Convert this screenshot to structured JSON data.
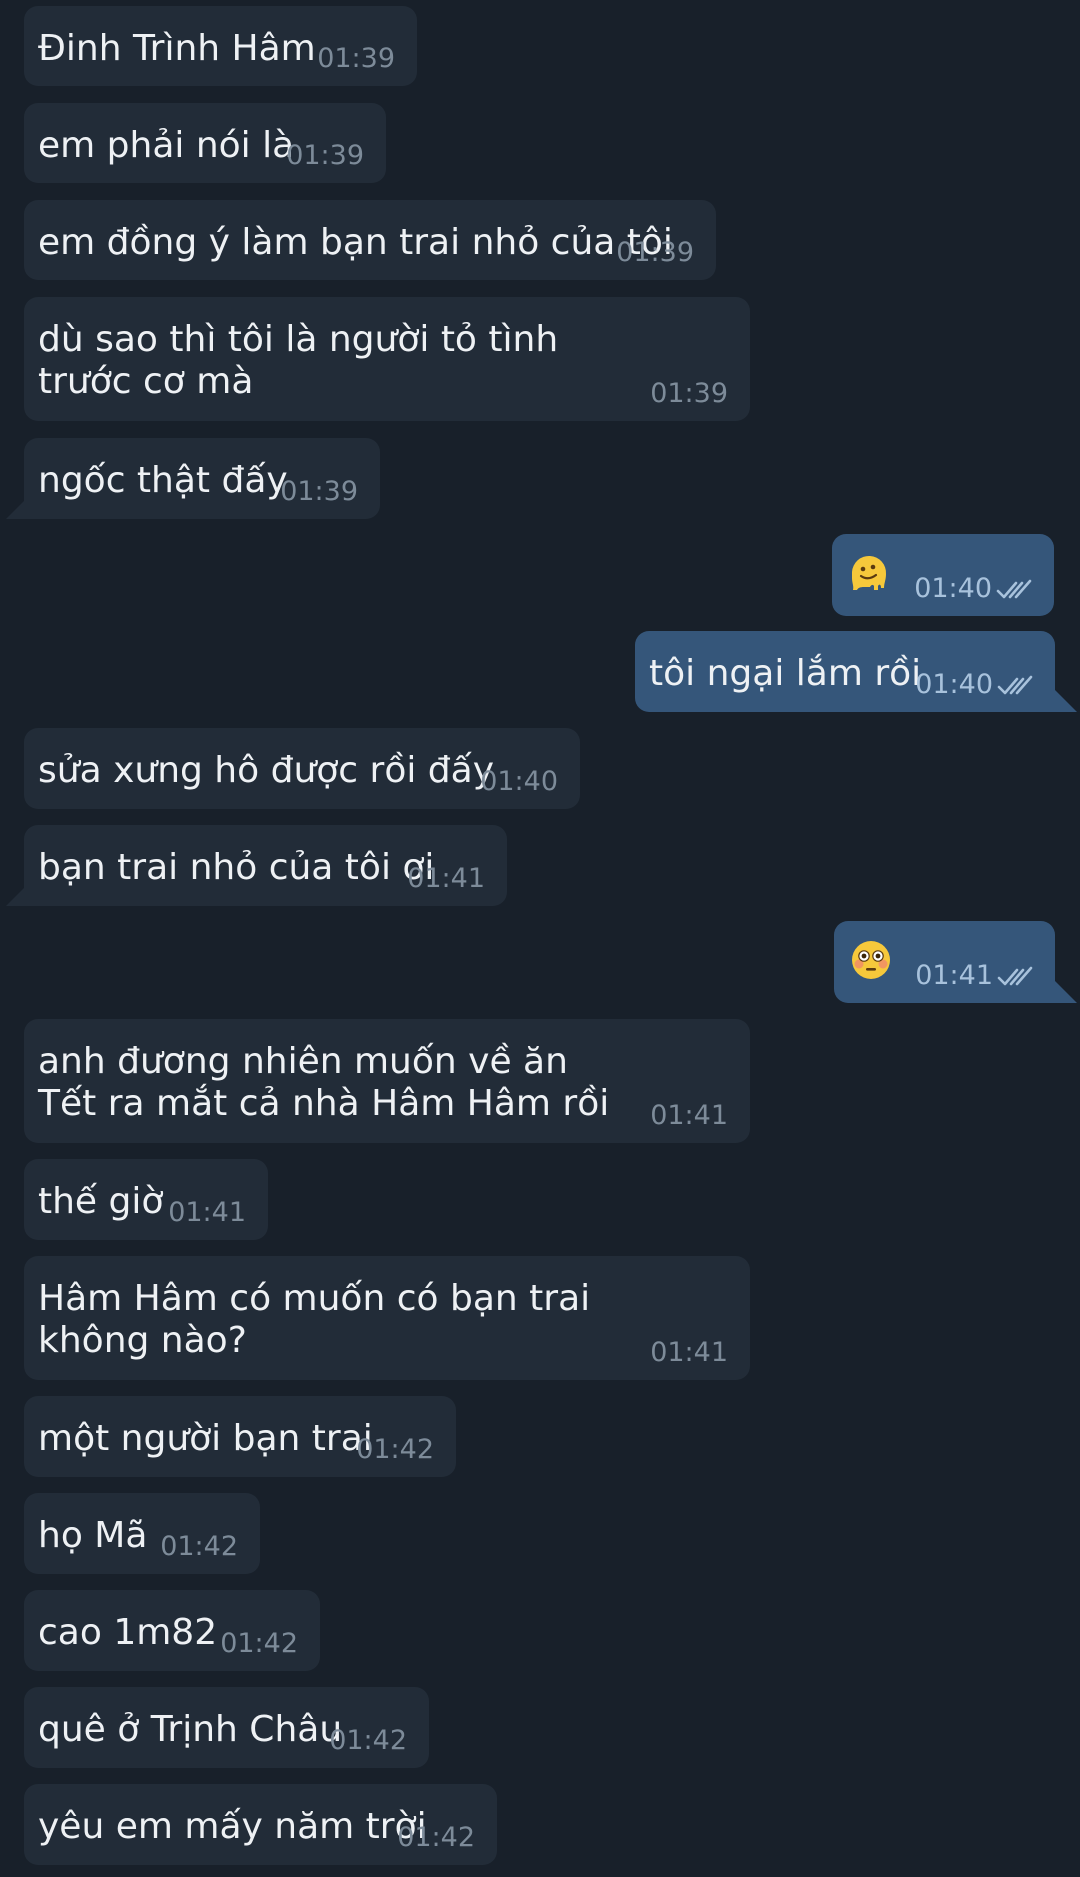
{
  "messages": [
    {
      "dir": "in",
      "text": "Đinh Trình Hâm",
      "time": "01:39"
    },
    {
      "dir": "in",
      "text": "em phải nói là",
      "time": "01:39"
    },
    {
      "dir": "in",
      "text": "em đồng ý làm bạn trai nhỏ của tôi",
      "time": "01:39"
    },
    {
      "dir": "in",
      "text": "dù sao thì tôi là người tỏ tình trước cơ mà",
      "time": "01:39"
    },
    {
      "dir": "in",
      "text": "ngốc thật đấy",
      "time": "01:39"
    },
    {
      "dir": "out",
      "emoji": "melting-face-emoji",
      "time": "01:40",
      "status": "read"
    },
    {
      "dir": "out",
      "text": "tôi ngại lắm rồi",
      "time": "01:40",
      "status": "read"
    },
    {
      "dir": "in",
      "text": "sửa xưng hô được rồi đấy",
      "time": "01:40"
    },
    {
      "dir": "in",
      "text": "bạn trai nhỏ của tôi ơi",
      "time": "01:41"
    },
    {
      "dir": "out",
      "emoji": "flushed-face-emoji",
      "time": "01:41",
      "status": "read"
    },
    {
      "dir": "in",
      "text": "anh đương nhiên muốn về ăn Tết ra mắt cả nhà Hâm Hâm rồi",
      "time": "01:41"
    },
    {
      "dir": "in",
      "text": "thế giờ",
      "time": "01:41"
    },
    {
      "dir": "in",
      "text": "Hâm Hâm có muốn có bạn trai không nào?",
      "time": "01:41"
    },
    {
      "dir": "in",
      "text": "một người bạn trai",
      "time": "01:42"
    },
    {
      "dir": "in",
      "text": "họ Mã",
      "time": "01:42"
    },
    {
      "dir": "in",
      "text": "cao 1m82",
      "time": "01:42"
    },
    {
      "dir": "in",
      "text": "quê ở Trịnh Châu",
      "time": "01:42"
    },
    {
      "dir": "in",
      "text": "yêu em mấy năm trời",
      "time": "01:42"
    }
  ],
  "colors": {
    "background": "#18202a",
    "incoming_bubble": "#222c38",
    "outgoing_bubble": "#35567a",
    "text": "#eef1f4",
    "incoming_time": "#7d8b99",
    "outgoing_time": "#a8c2dc",
    "read_check": "#a8c2dc"
  }
}
